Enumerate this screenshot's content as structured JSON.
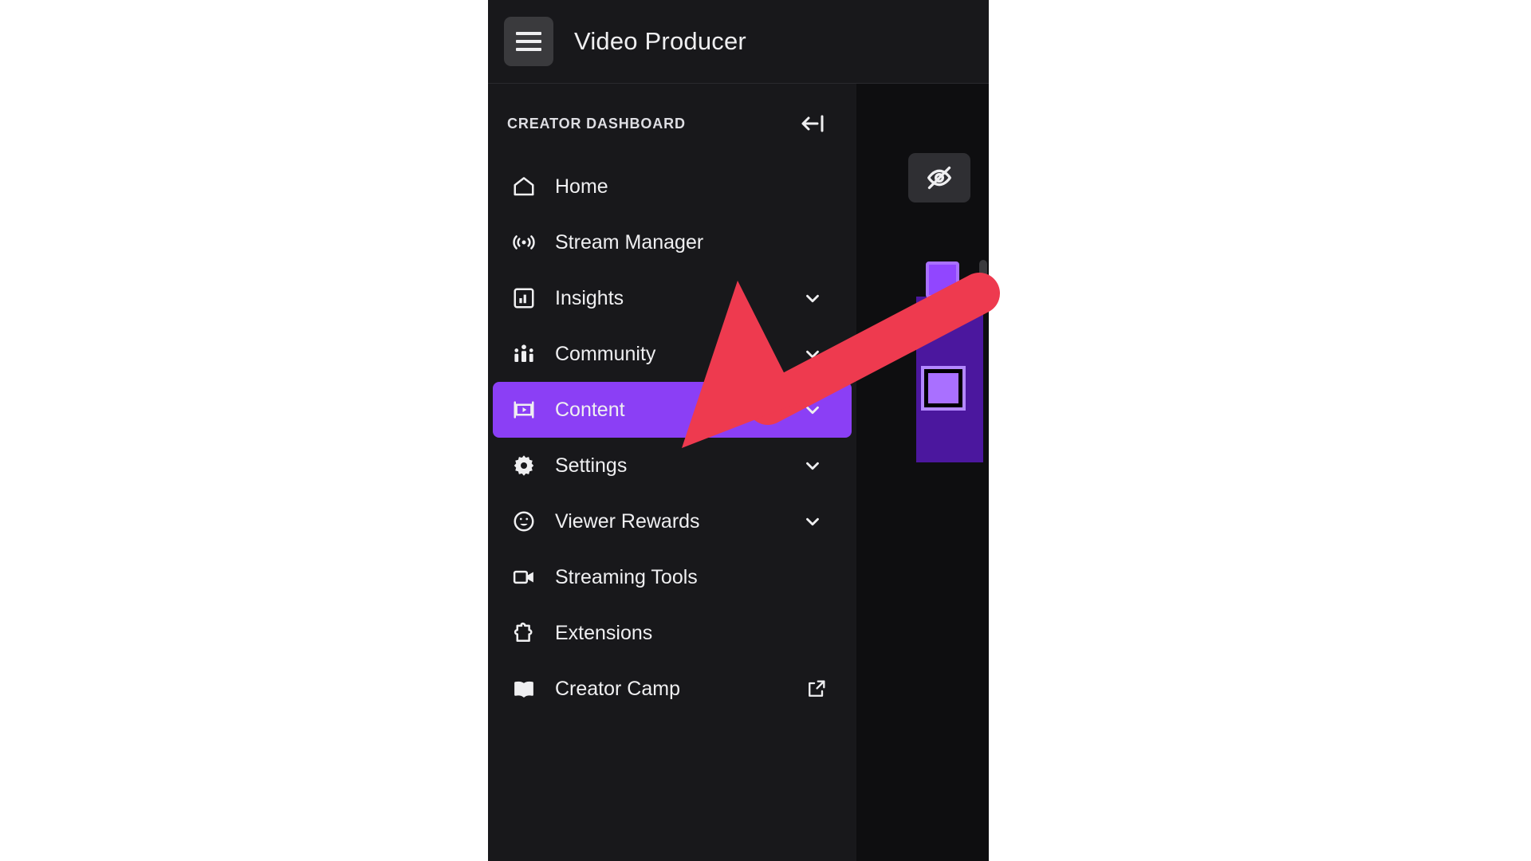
{
  "app": {
    "title": "Video Producer",
    "menu_button_icon": "hamburger-icon"
  },
  "sidebar": {
    "header": {
      "title": "CREATOR DASHBOARD",
      "collapse_icon": "collapse-left-icon"
    },
    "items": [
      {
        "label": "Home",
        "icon": "home-icon",
        "chevron": false,
        "external": false,
        "active": false
      },
      {
        "label": "Stream Manager",
        "icon": "broadcast-icon",
        "chevron": false,
        "external": false,
        "active": false
      },
      {
        "label": "Insights",
        "icon": "bar-chart-icon",
        "chevron": true,
        "external": false,
        "active": false
      },
      {
        "label": "Community",
        "icon": "people-icon",
        "chevron": true,
        "external": false,
        "active": false
      },
      {
        "label": "Content",
        "icon": "video-frame-icon",
        "chevron": true,
        "external": false,
        "active": true
      },
      {
        "label": "Settings",
        "icon": "gear-icon",
        "chevron": true,
        "external": false,
        "active": false
      },
      {
        "label": "Viewer Rewards",
        "icon": "smiley-icon",
        "chevron": true,
        "external": false,
        "active": false
      },
      {
        "label": "Streaming Tools",
        "icon": "video-cam-icon",
        "chevron": false,
        "external": false,
        "active": false
      },
      {
        "label": "Extensions",
        "icon": "puzzle-icon",
        "chevron": false,
        "external": false,
        "active": false
      },
      {
        "label": "Creator Camp",
        "icon": "book-icon",
        "chevron": false,
        "external": true,
        "active": false
      }
    ]
  },
  "content_panel": {
    "hide_preview_icon": "eye-off-icon",
    "marker_small_icon": "square-marker-icon",
    "marker_large_icon": "square-marker-icon"
  },
  "annotation": {
    "type": "arrow",
    "points_to": "Content",
    "color": "#ee3a4f"
  },
  "colors": {
    "accent_purple": "#8b3ff5",
    "panel_purple": "#4b179e",
    "marker_purple": "#a970ff",
    "window_bg": "#0e0e10",
    "nav_bg": "#18181b",
    "text": "#efeff1",
    "arrow_red": "#ee3a4f"
  }
}
